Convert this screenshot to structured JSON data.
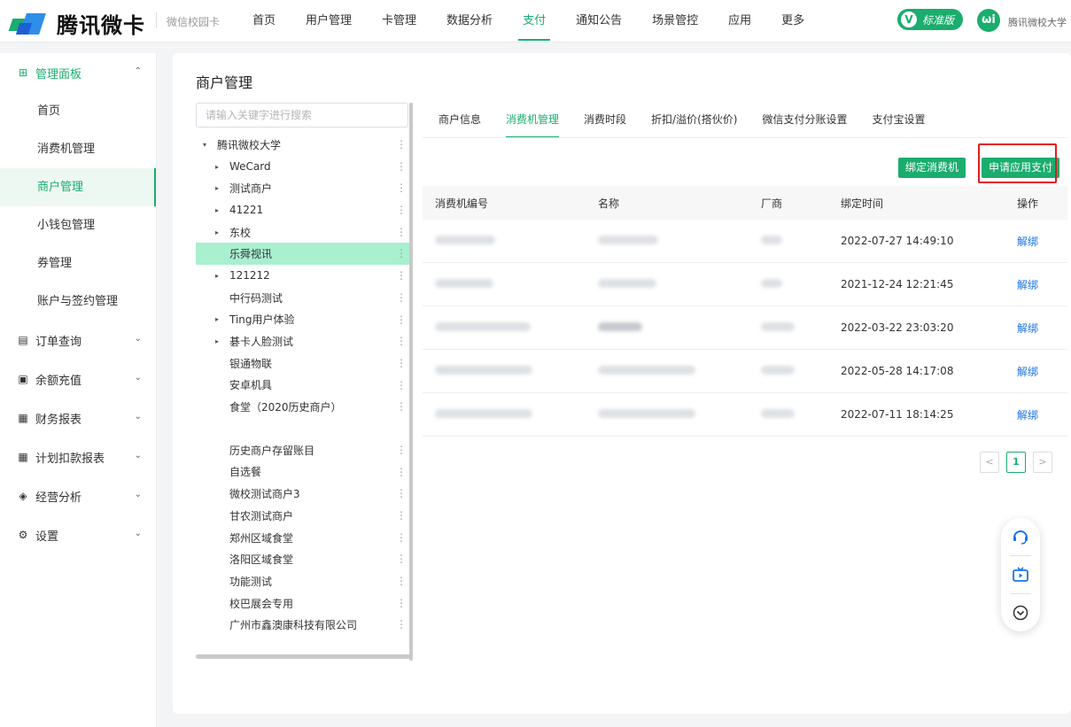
{
  "topbar": {
    "brand": "腾讯微卡",
    "sub_brand": "微信校园卡",
    "nav": [
      "首页",
      "用户管理",
      "卡管理",
      "数据分析",
      "支付",
      "通知公告",
      "场景管控",
      "应用",
      "更多"
    ],
    "active_nav": "支付",
    "edition_letter": "V",
    "edition_label": "标准版",
    "school_logo": "ωi",
    "school_name": "腾讯微校大学"
  },
  "sidebar": {
    "groups": [
      {
        "label": "管理面板",
        "icon": "dashboard-icon"
      },
      {
        "label": "订单查询",
        "icon": "order-icon"
      },
      {
        "label": "余额充值",
        "icon": "recharge-icon"
      },
      {
        "label": "财务报表",
        "icon": "report-icon"
      },
      {
        "label": "计划扣款报表",
        "icon": "plan-report-icon"
      },
      {
        "label": "经营分析",
        "icon": "analysis-icon"
      },
      {
        "label": "设置",
        "icon": "settings-icon"
      }
    ],
    "sub_items": [
      "首页",
      "消费机管理",
      "商户管理",
      "小钱包管理",
      "券管理",
      "账户与签约管理"
    ],
    "active_sub": "商户管理"
  },
  "main": {
    "title": "商户管理",
    "search_placeholder": "请输入关键字进行搜索",
    "tree": [
      {
        "label": "腾讯微校大学",
        "level": 0,
        "arrow": "▾"
      },
      {
        "label": "WeCard",
        "level": 1,
        "arrow": "▸"
      },
      {
        "label": "测试商户",
        "level": 1,
        "arrow": "▸"
      },
      {
        "label": "41221",
        "level": 1,
        "arrow": "▸"
      },
      {
        "label": "东校",
        "level": 1,
        "arrow": "▸"
      },
      {
        "label": "乐舜视讯",
        "level": 1,
        "arrow": ""
      },
      {
        "label": "121212",
        "level": 1,
        "arrow": "▸"
      },
      {
        "label": "中行码测试",
        "level": 1,
        "arrow": ""
      },
      {
        "label": "Ting用户体验",
        "level": 1,
        "arrow": "▸"
      },
      {
        "label": "碁卡人脸测试",
        "level": 1,
        "arrow": "▸"
      },
      {
        "label": "银通物联",
        "level": 1,
        "arrow": ""
      },
      {
        "label": "安卓机具",
        "level": 1,
        "arrow": ""
      },
      {
        "label": "食堂（2020历史商户）",
        "level": 1,
        "arrow": ""
      },
      {
        "label": "",
        "level": 1,
        "arrow": ""
      },
      {
        "label": "历史商户存留账目",
        "level": 1,
        "arrow": ""
      },
      {
        "label": "自选餐",
        "level": 1,
        "arrow": ""
      },
      {
        "label": "微校测试商户3",
        "level": 1,
        "arrow": ""
      },
      {
        "label": "甘农测试商户",
        "level": 1,
        "arrow": ""
      },
      {
        "label": "郑州区域食堂",
        "level": 1,
        "arrow": ""
      },
      {
        "label": "洛阳区域食堂",
        "level": 1,
        "arrow": ""
      },
      {
        "label": "功能测试",
        "level": 1,
        "arrow": ""
      },
      {
        "label": "校巴展会专用",
        "level": 1,
        "arrow": ""
      },
      {
        "label": "广州市鑫澳康科技有限公司",
        "level": 1,
        "arrow": ""
      }
    ],
    "selected_tree_item": "乐舜视讯",
    "more_glyph": "⋮",
    "tabs": [
      "商户信息",
      "消费机管理",
      "消费时段",
      "折扣/溢价(搭伙价)",
      "微信支付分账设置",
      "支付宝设置"
    ],
    "active_tab": "消费机管理",
    "bind_button": "绑定消费机",
    "apply_button": "申请应用支付",
    "table": {
      "headers": [
        "消费机编号",
        "名称",
        "厂商",
        "绑定时间",
        "操作"
      ],
      "rows": [
        {
          "bind_time": "2022-07-27 14:49:10",
          "action": "解绑"
        },
        {
          "bind_time": "2021-12-24 12:21:45",
          "action": "解绑"
        },
        {
          "bind_time": "2022-03-22 23:03:20",
          "action": "解绑"
        },
        {
          "bind_time": "2022-05-28 14:17:08",
          "action": "解绑"
        },
        {
          "bind_time": "2022-07-11 18:14:25",
          "action": "解绑"
        }
      ]
    },
    "pagination": {
      "prev": "<",
      "current": "1",
      "next": ">"
    }
  },
  "colors": {
    "accent": "#1aad6e",
    "link": "#1a73e8",
    "highlight": "#e21d1d"
  }
}
